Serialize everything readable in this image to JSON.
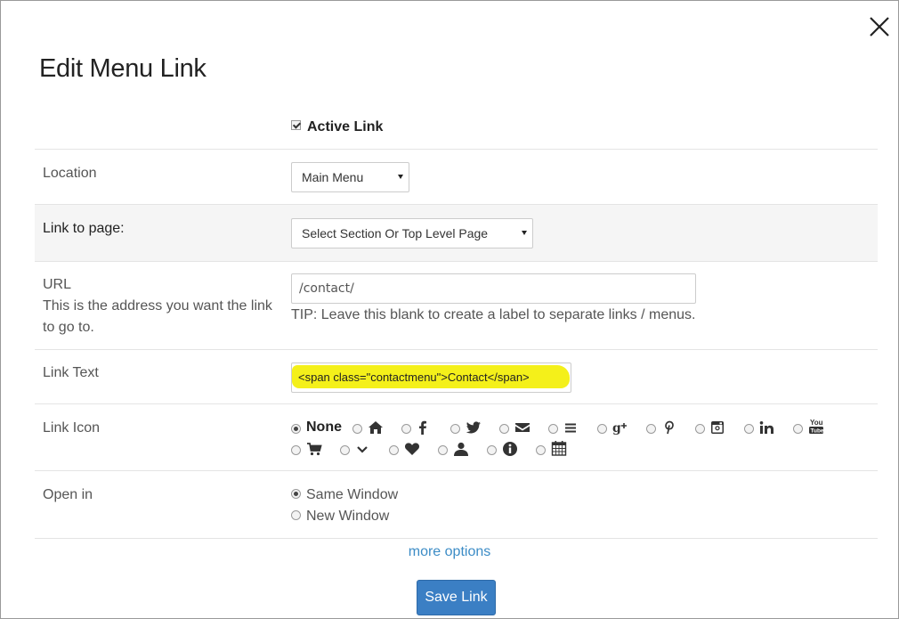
{
  "dialog": {
    "title": "Edit Menu Link",
    "close_icon": "close-icon"
  },
  "active": {
    "label": "Active Link",
    "checked": true
  },
  "location": {
    "label": "Location",
    "value": "Main Menu"
  },
  "link_page": {
    "label": "Link to page:",
    "value": "Select Section Or Top Level Page"
  },
  "url": {
    "label": "URL",
    "help": "This is the address you want the link to go to.",
    "value": "/contact/",
    "tip": "TIP: Leave this blank to create a label to separate links / menus."
  },
  "link_text": {
    "label": "Link Text",
    "value": "<span class=\"contactmenu\">Contact</span>",
    "highlight_color": "#f4f01a"
  },
  "link_icon": {
    "label": "Link Icon",
    "none_label": "None",
    "selected": "None",
    "icons": [
      "home-icon",
      "facebook-icon",
      "twitter-icon",
      "envelope-icon",
      "list-icon",
      "google-plus-icon",
      "pinterest-icon",
      "instagram-icon",
      "linkedin-icon",
      "youtube-icon",
      "shopping-cart-icon",
      "chevron-down-icon",
      "heart-icon",
      "user-icon",
      "info-icon",
      "calendar-icon"
    ]
  },
  "open_in": {
    "label": "Open in",
    "options": [
      "Same Window",
      "New Window"
    ],
    "selected": "Same Window"
  },
  "more_options": "more options",
  "save_button": "Save Link",
  "colors": {
    "primary": "#3b7fc4",
    "link": "#3c8cc6",
    "highlight": "#f4f01a"
  }
}
